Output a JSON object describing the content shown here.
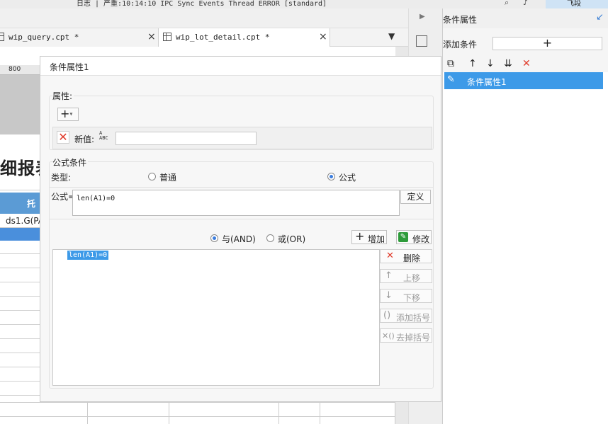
{
  "topbar": {
    "log_text": "日志 | 严重:10:14:10 IPC Sync Events Thread ERROR [standard]",
    "right_label": "飞段"
  },
  "tabs": [
    {
      "label": "wip_query.cpt *",
      "close": "×"
    },
    {
      "label": "wip_lot_detail.cpt *",
      "close": "×"
    }
  ],
  "tab_menu_icon": "▼",
  "side": {
    "arrow": "▶"
  },
  "report": {
    "ruler_mark": "800",
    "title_fragment": "细报表",
    "header_fragment": "托",
    "cell_fragment": "ds1.G(PA"
  },
  "dialog": {
    "title": "条件属性1",
    "attribute": {
      "section_label": "属性:",
      "add_button": "+",
      "new_value_label": "新值:",
      "new_value_input": "",
      "abc_text": "A\nABC",
      "delete_icon": "✕"
    },
    "formula": {
      "section_label": "公式条件",
      "type_label": "类型:",
      "normal_label": "普通",
      "formula_label": "公式",
      "selected_type": "formula",
      "fx_label": "公式=",
      "fx_value": "len(A1)=0",
      "define_button": "定义",
      "and_label": "与(AND)",
      "or_label": "或(OR)",
      "selected_logic": "and",
      "add_button": "增加",
      "edit_button": "修改",
      "conditions": [
        "len(A1)=0"
      ],
      "side_buttons": [
        {
          "label": "删除",
          "icon": "✕",
          "enabled": true
        },
        {
          "label": "上移",
          "icon": "↑",
          "enabled": false
        },
        {
          "label": "下移",
          "icon": "↓",
          "enabled": false
        },
        {
          "label": "添加括号",
          "icon": "()",
          "enabled": false
        },
        {
          "label": "去掉括号",
          "icon": "✕()",
          "enabled": false
        }
      ]
    }
  },
  "right_panel": {
    "title": "条件属性",
    "pin_icon": "↙",
    "add_label": "添加条件",
    "add_button": "+",
    "tools": {
      "copy": "⧉",
      "up": "↑",
      "down": "↓",
      "sort": "⇊",
      "delete": "✕"
    },
    "selected_item": "条件属性1",
    "selected_icon": "✎"
  }
}
